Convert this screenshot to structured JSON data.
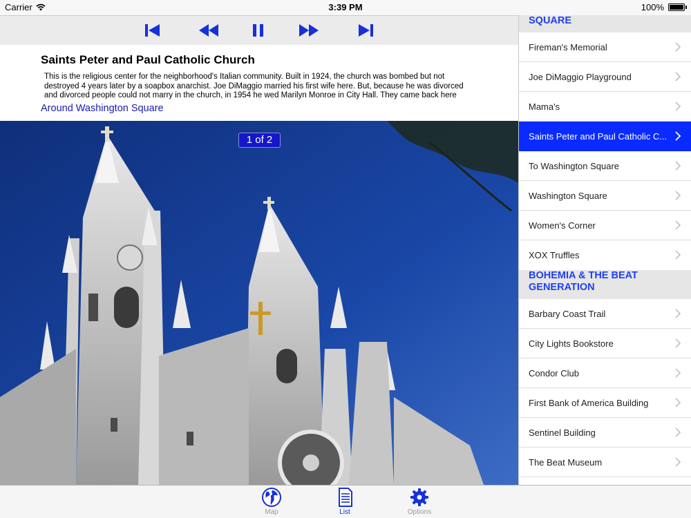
{
  "status": {
    "carrier": "Carrier",
    "time": "3:39 PM",
    "battery": "100%"
  },
  "player": {
    "controls": [
      "skip-back",
      "rewind",
      "pause",
      "fast-forward",
      "skip-forward"
    ]
  },
  "detail": {
    "title": "Saints Peter and Paul Catholic Church",
    "description": "This is the religious center for the neighborhood's Italian community. Built in 1924, the church was bombed but not destroyed 4 years later by a soapbox anarchist. Joe DiMaggio married his first wife here. But, because he was divorced and divorced people could not marry in the church, in 1954 he wed Marilyn Monroe in City Hall. They came back here",
    "link": "Around Washington Square"
  },
  "photo": {
    "page_indicator": "1 of 2"
  },
  "list": {
    "section1_header": "SQUARE",
    "section1_items": [
      "Fireman's Memorial",
      "Joe DiMaggio Playground",
      "Mama's",
      "Saints Peter and Paul Catholic C...",
      "To Washington Square",
      "Washington Square",
      "Women's Corner",
      "XOX Truffles"
    ],
    "section2_header_line1": "BOHEMIA & THE BEAT",
    "section2_header_line2": "GENERATION",
    "section2_items": [
      "Barbary Coast Trail",
      "City Lights Bookstore",
      "Condor Club",
      "First Bank of America Building",
      "Sentinel Building",
      "The Beat Museum"
    ]
  },
  "tabs": {
    "map": "Map",
    "list": "List",
    "options": "Options"
  },
  "colors": {
    "accent": "#0a2bff",
    "section_header": "#1f3ff5",
    "player_icons": "#1730d8"
  }
}
